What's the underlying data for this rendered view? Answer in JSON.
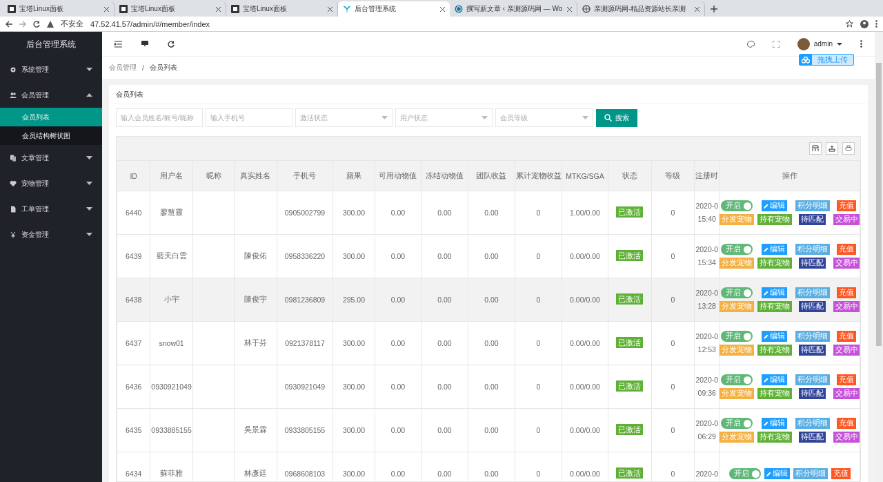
{
  "browser": {
    "tabs": [
      {
        "title": "宝塔Linux面板",
        "selected": false
      },
      {
        "title": "宝塔Linux面板",
        "selected": false
      },
      {
        "title": "宝塔Linux面板",
        "selected": false
      },
      {
        "title": "后台管理系统",
        "selected": true
      },
      {
        "title": "撰写新文章 ‹ 亲测源码网 — Wo",
        "selected": false
      },
      {
        "title": "亲测源码网-精品资源站长亲测",
        "selected": false
      }
    ],
    "security": "不安全",
    "url": "47.52.41.57/admin/#/member/index"
  },
  "sidebar": {
    "title": "后台管理系统",
    "items": [
      {
        "label": "系统管理",
        "expanded": false
      },
      {
        "label": "会员管理",
        "expanded": true,
        "children": [
          {
            "label": "会员列表",
            "selected": true
          },
          {
            "label": "会员结构树状图",
            "selected": false
          }
        ]
      },
      {
        "label": "文章管理",
        "expanded": false
      },
      {
        "label": "宠物管理",
        "expanded": false
      },
      {
        "label": "工单管理",
        "expanded": false
      },
      {
        "label": "资金管理",
        "expanded": false
      }
    ]
  },
  "header": {
    "user": "admin",
    "upload": "拖拽上传"
  },
  "breadcrumb": {
    "items": [
      "会员管理",
      "会员列表"
    ],
    "separator": "/"
  },
  "card_title": "会员列表",
  "filters": [
    {
      "kind": "input",
      "placeholder": "输入会员姓名/账号/昵称"
    },
    {
      "kind": "input",
      "placeholder": "输入手机号"
    },
    {
      "kind": "select",
      "placeholder": "激活状态"
    },
    {
      "kind": "select",
      "placeholder": "用户状态"
    },
    {
      "kind": "select",
      "placeholder": "会员等级"
    }
  ],
  "search_button": "搜索",
  "table": {
    "columns": [
      "ID",
      "用户名",
      "昵称",
      "真实姓名",
      "手机号",
      "蘋果",
      "可用动物值",
      "冻结动物值",
      "团队收益",
      "累计宠物收益",
      "MTKG/SGA",
      "状态",
      "等级",
      "注册时",
      "操作"
    ],
    "rows": [
      {
        "highlighted": false,
        "cells": [
          "6440",
          "廖慧靈",
          "",
          "",
          "0905002799",
          "300.00",
          "0.00",
          "0.00",
          "0.00",
          "0",
          "1.00/0.00"
        ],
        "status": "已激活",
        "level": "0",
        "date": "2020-0",
        "time": "15:40",
        "switch": {
          "label": "开启",
          "on": true
        },
        "actions": [
          {
            "label": "编辑",
            "kind": "edit",
            "color": "#1e9fff"
          },
          {
            "label": "积分明细",
            "kind": "plain",
            "color": "#5aaee3"
          },
          {
            "label": "充值",
            "kind": "plain",
            "color": "#ff5722"
          },
          {
            "label": "分发宠物",
            "kind": "plain",
            "color": "#f5b041"
          },
          {
            "label": "持有宠物",
            "kind": "plain",
            "color": "#5fb136"
          },
          {
            "label": "待匹配",
            "kind": "plain",
            "color": "#2f4399"
          },
          {
            "label": "交易中",
            "kind": "plain",
            "color": "#c552d8"
          }
        ]
      },
      {
        "highlighted": false,
        "cells": [
          "6439",
          "藍天白雲",
          "",
          "陳俊佑",
          "0958336220",
          "300.00",
          "0.00",
          "0.00",
          "0.00",
          "0",
          "0.00/0.00"
        ],
        "status": "已激活",
        "level": "0",
        "date": "2020-0",
        "time": "15:34",
        "switch": {
          "label": "开启",
          "on": true
        },
        "actions": [
          {
            "label": "编辑",
            "kind": "edit",
            "color": "#1e9fff"
          },
          {
            "label": "积分明细",
            "kind": "plain",
            "color": "#5aaee3"
          },
          {
            "label": "充值",
            "kind": "plain",
            "color": "#ff5722"
          },
          {
            "label": "分发宠物",
            "kind": "plain",
            "color": "#f5b041"
          },
          {
            "label": "持有宠物",
            "kind": "plain",
            "color": "#5fb136"
          },
          {
            "label": "待匹配",
            "kind": "plain",
            "color": "#2f4399"
          },
          {
            "label": "交易中",
            "kind": "plain",
            "color": "#c552d8"
          }
        ]
      },
      {
        "highlighted": true,
        "cells": [
          "6438",
          "小宇",
          "",
          "陳俊宇",
          "0981236809",
          "295.00",
          "0.00",
          "0.00",
          "0.00",
          "0",
          "0.00/0.00"
        ],
        "status": "已激活",
        "level": "0",
        "date": "2020-0",
        "time": "13:28",
        "switch": {
          "label": "开启",
          "on": true
        },
        "actions": [
          {
            "label": "编辑",
            "kind": "edit",
            "color": "#1e9fff"
          },
          {
            "label": "积分明细",
            "kind": "plain",
            "color": "#5aaee3"
          },
          {
            "label": "充值",
            "kind": "plain",
            "color": "#ff5722"
          },
          {
            "label": "分发宠物",
            "kind": "plain",
            "color": "#f5b041"
          },
          {
            "label": "持有宠物",
            "kind": "plain",
            "color": "#5fb136"
          },
          {
            "label": "待匹配",
            "kind": "plain",
            "color": "#2f4399"
          },
          {
            "label": "交易中",
            "kind": "plain",
            "color": "#c552d8"
          }
        ]
      },
      {
        "highlighted": false,
        "cells": [
          "6437",
          "snow01",
          "",
          "林于芬",
          "0921378117",
          "300.00",
          "0.00",
          "0.00",
          "0.00",
          "0",
          "0.00/0.00"
        ],
        "status": "已激活",
        "level": "0",
        "date": "2020-0",
        "time": "12:53",
        "switch": {
          "label": "开启",
          "on": true
        },
        "actions": [
          {
            "label": "编辑",
            "kind": "edit",
            "color": "#1e9fff"
          },
          {
            "label": "积分明细",
            "kind": "plain",
            "color": "#5aaee3"
          },
          {
            "label": "充值",
            "kind": "plain",
            "color": "#ff5722"
          },
          {
            "label": "分发宠物",
            "kind": "plain",
            "color": "#f5b041"
          },
          {
            "label": "持有宠物",
            "kind": "plain",
            "color": "#5fb136"
          },
          {
            "label": "待匹配",
            "kind": "plain",
            "color": "#2f4399"
          },
          {
            "label": "交易中",
            "kind": "plain",
            "color": "#c552d8"
          }
        ]
      },
      {
        "highlighted": false,
        "cells": [
          "6436",
          "0930921049",
          "",
          "",
          "0930921049",
          "300.00",
          "0.00",
          "0.00",
          "0.00",
          "0",
          "0.00/0.00"
        ],
        "status": "已激活",
        "level": "0",
        "date": "2020-0",
        "time": "09:36",
        "switch": {
          "label": "开启",
          "on": true
        },
        "actions": [
          {
            "label": "编辑",
            "kind": "edit",
            "color": "#1e9fff"
          },
          {
            "label": "积分明细",
            "kind": "plain",
            "color": "#5aaee3"
          },
          {
            "label": "充值",
            "kind": "plain",
            "color": "#ff5722"
          },
          {
            "label": "分发宠物",
            "kind": "plain",
            "color": "#f5b041"
          },
          {
            "label": "持有宠物",
            "kind": "plain",
            "color": "#5fb136"
          },
          {
            "label": "待匹配",
            "kind": "plain",
            "color": "#2f4399"
          },
          {
            "label": "交易中",
            "kind": "plain",
            "color": "#c552d8"
          }
        ]
      },
      {
        "highlighted": false,
        "cells": [
          "6435",
          "0933885155",
          "",
          "吳景霖",
          "0933805155",
          "300.00",
          "0.00",
          "0.00",
          "0.00",
          "0",
          "0.00/0.00"
        ],
        "status": "已激活",
        "level": "0",
        "date": "2020-0",
        "time": "06:29",
        "switch": {
          "label": "开启",
          "on": true
        },
        "actions": [
          {
            "label": "编辑",
            "kind": "edit",
            "color": "#1e9fff"
          },
          {
            "label": "积分明细",
            "kind": "plain",
            "color": "#5aaee3"
          },
          {
            "label": "充值",
            "kind": "plain",
            "color": "#ff5722"
          },
          {
            "label": "分发宠物",
            "kind": "plain",
            "color": "#f5b041"
          },
          {
            "label": "持有宠物",
            "kind": "plain",
            "color": "#5fb136"
          },
          {
            "label": "待匹配",
            "kind": "plain",
            "color": "#2f4399"
          },
          {
            "label": "交易中",
            "kind": "plain",
            "color": "#c552d8"
          }
        ]
      },
      {
        "highlighted": false,
        "cells": [
          "6434",
          "蘇菲雅",
          "",
          "林彥廷",
          "0968608103",
          "300.00",
          "0.00",
          "0.00",
          "0.00",
          "0",
          "0.00/0.00"
        ],
        "status": "已激活",
        "level": "0",
        "date": "2020-0",
        "switch": {
          "label": "开启",
          "on": true
        },
        "actions": [
          {
            "label": "编辑",
            "kind": "edit",
            "color": "#1e9fff"
          },
          {
            "label": "积分明细",
            "kind": "plain",
            "color": "#5aaee3"
          },
          {
            "label": "充值",
            "kind": "plain",
            "color": "#ff5722"
          }
        ]
      }
    ]
  }
}
